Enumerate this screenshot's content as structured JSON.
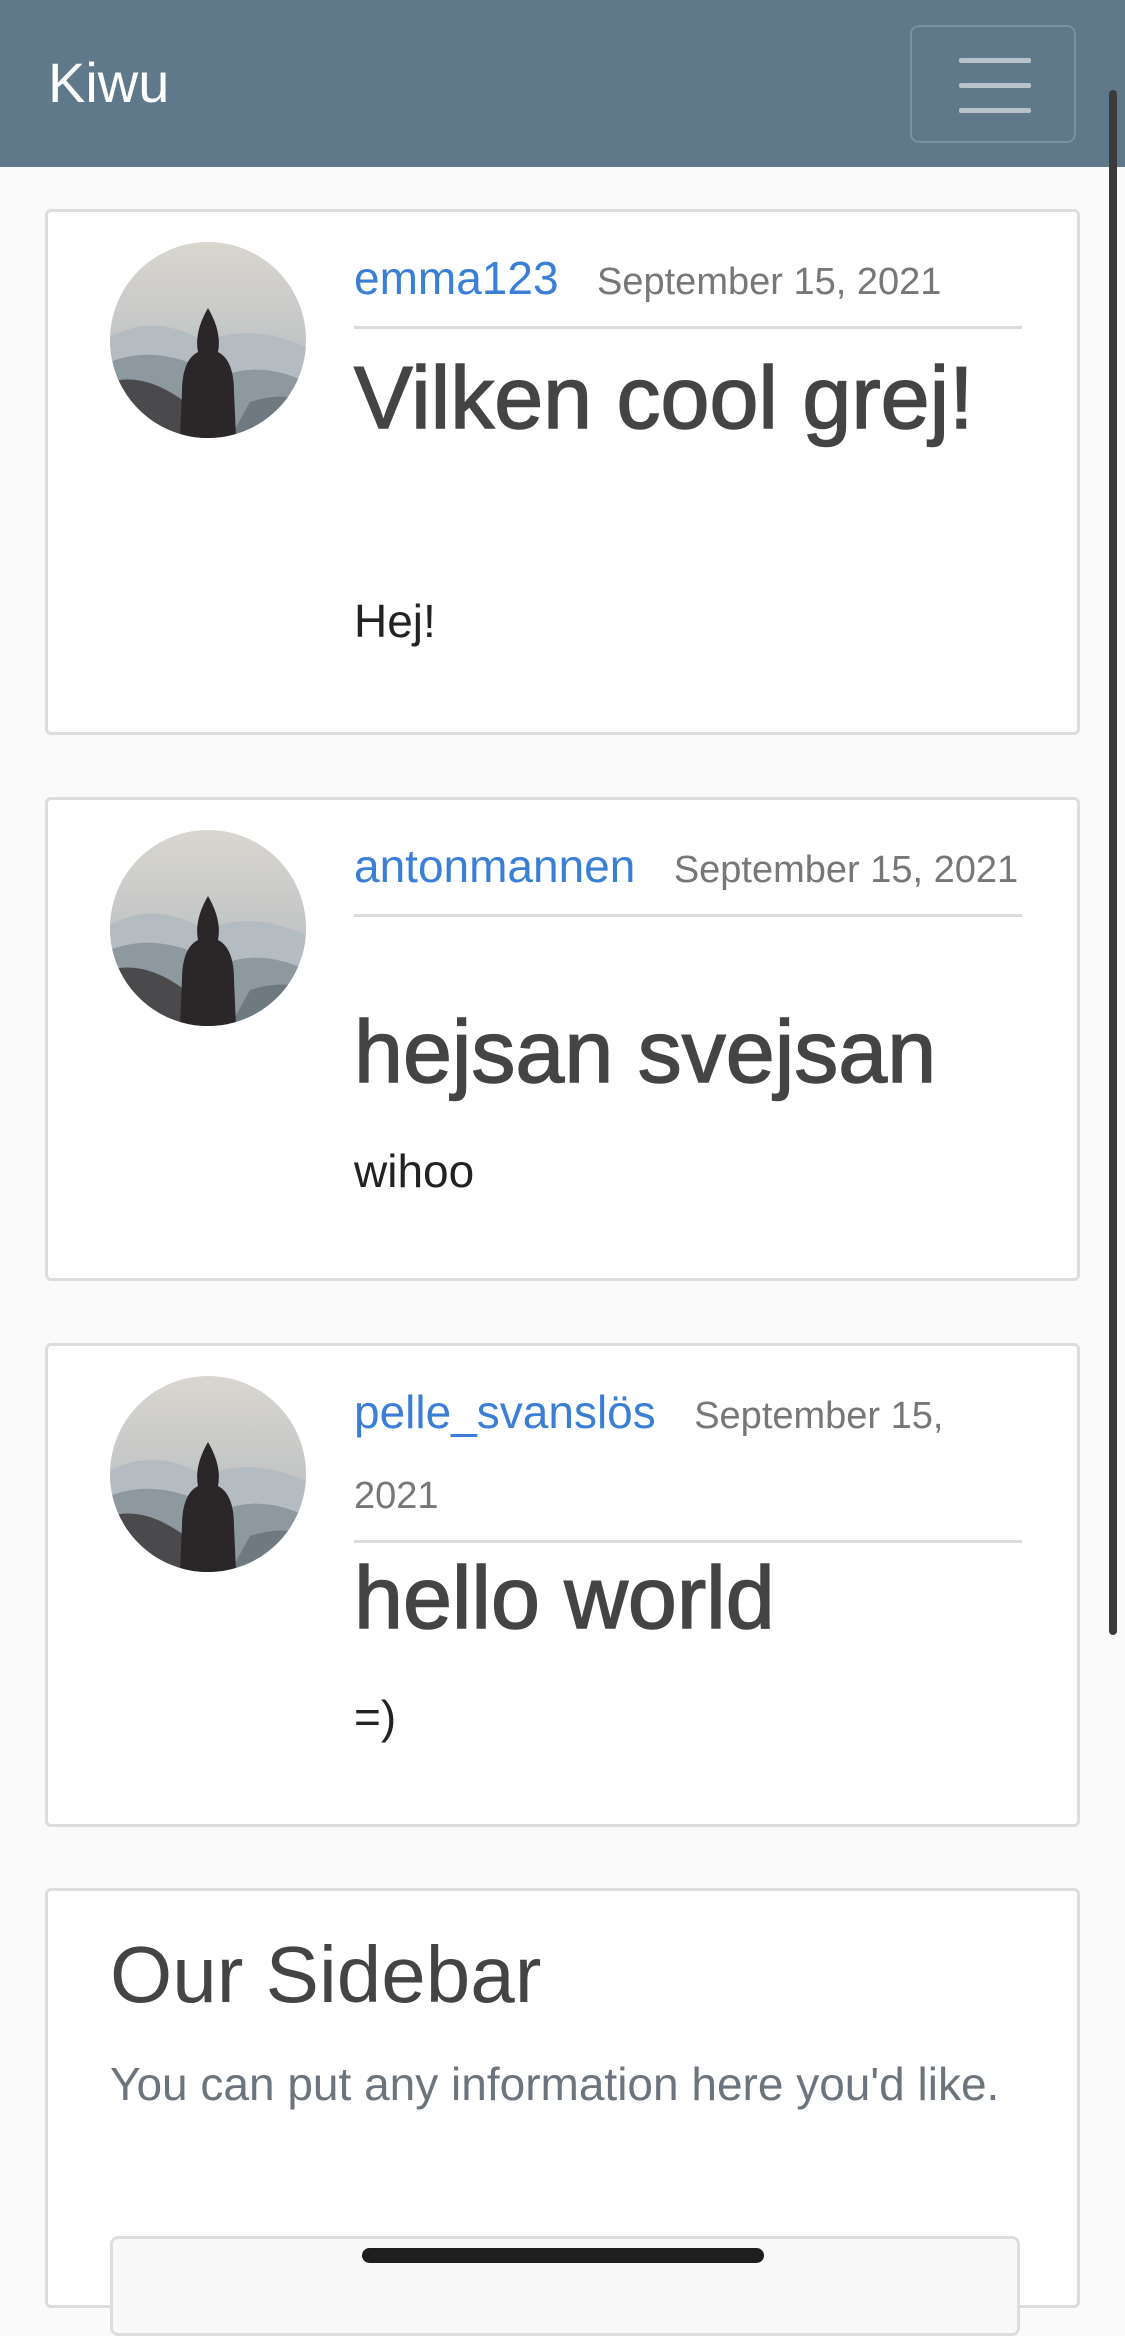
{
  "navbar": {
    "brand": "Kiwu",
    "toggler_icon": "hamburger-menu-icon"
  },
  "posts": [
    {
      "author": "emma123",
      "date": "September 15, 2021",
      "title": "Vilken cool grej!",
      "content": "Hej!"
    },
    {
      "author": "antonmannen",
      "date": "September 15, 2021",
      "title": "hejsan svejsan",
      "content": "wihoo"
    },
    {
      "author": "pelle_svanslös",
      "date": "September 15, 2021",
      "title": "hello world",
      "content": "=)"
    }
  ],
  "sidebar": {
    "title": "Our Sidebar",
    "text": "You can put any information here you'd like."
  },
  "colors": {
    "navbar_bg": "#5f788a",
    "author_link": "#3a7fd5",
    "page_bg": "#fafafa"
  }
}
